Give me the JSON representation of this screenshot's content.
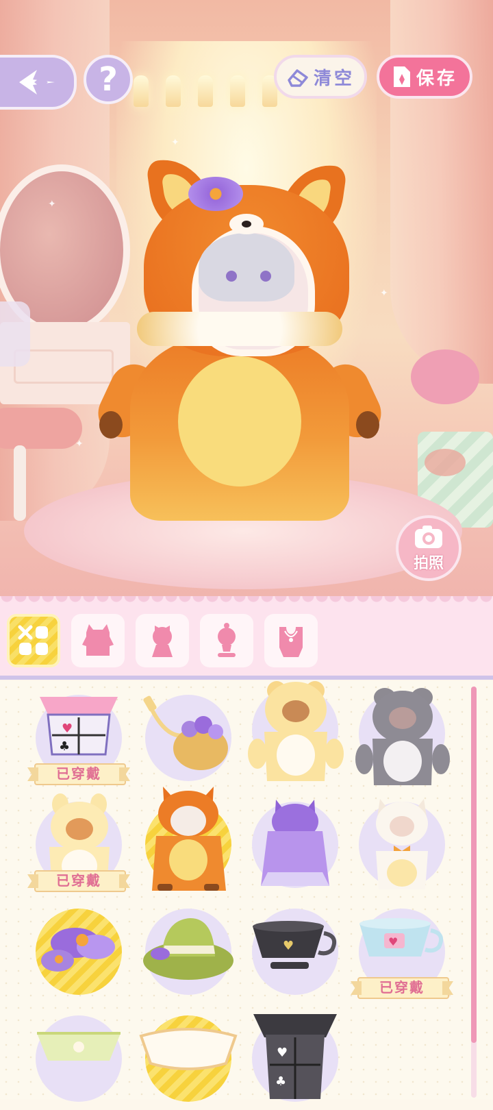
{
  "hud": {
    "clear_label": "清空",
    "save_label": "保存",
    "help_label": "?",
    "photo_label": "拍照"
  },
  "categories": [
    {
      "name": "all",
      "active": true
    },
    {
      "name": "outfit",
      "active": false
    },
    {
      "name": "headwear",
      "active": false
    },
    {
      "name": "hair-accessory",
      "active": false
    },
    {
      "name": "necklace",
      "active": false
    }
  ],
  "items": [
    {
      "name": "card-suit-collar",
      "worn_label": "已穿戴",
      "selected": false
    },
    {
      "name": "flower-basket",
      "worn_label": "",
      "selected": false
    },
    {
      "name": "bear-costume",
      "worn_label": "",
      "selected": false
    },
    {
      "name": "gray-bunny-costume",
      "worn_label": "",
      "selected": false
    },
    {
      "name": "yellow-bunny-costume",
      "worn_label": "已穿戴",
      "selected": false
    },
    {
      "name": "fox-costume",
      "worn_label": "",
      "selected": true
    },
    {
      "name": "purple-cat-cloak",
      "worn_label": "",
      "selected": false
    },
    {
      "name": "white-cat-costume",
      "worn_label": "",
      "selected": false
    },
    {
      "name": "purple-flower-hairpin",
      "worn_label": "",
      "selected": true
    },
    {
      "name": "green-hat",
      "worn_label": "",
      "selected": false
    },
    {
      "name": "black-teacup-hat",
      "worn_label": "",
      "selected": false
    },
    {
      "name": "blue-teacup-hat",
      "worn_label": "已穿戴",
      "selected": false
    },
    {
      "name": "green-lace-collar",
      "worn_label": "",
      "selected": false
    },
    {
      "name": "white-ruffle-collar",
      "worn_label": "",
      "selected": true
    },
    {
      "name": "black-card-collar",
      "worn_label": "",
      "selected": false
    }
  ],
  "colors": {
    "accent_pink": "#f3739a",
    "accent_purple": "#c8b4e6",
    "selected_yellow": "#f7d23d",
    "worn_text": "#e06e93"
  }
}
